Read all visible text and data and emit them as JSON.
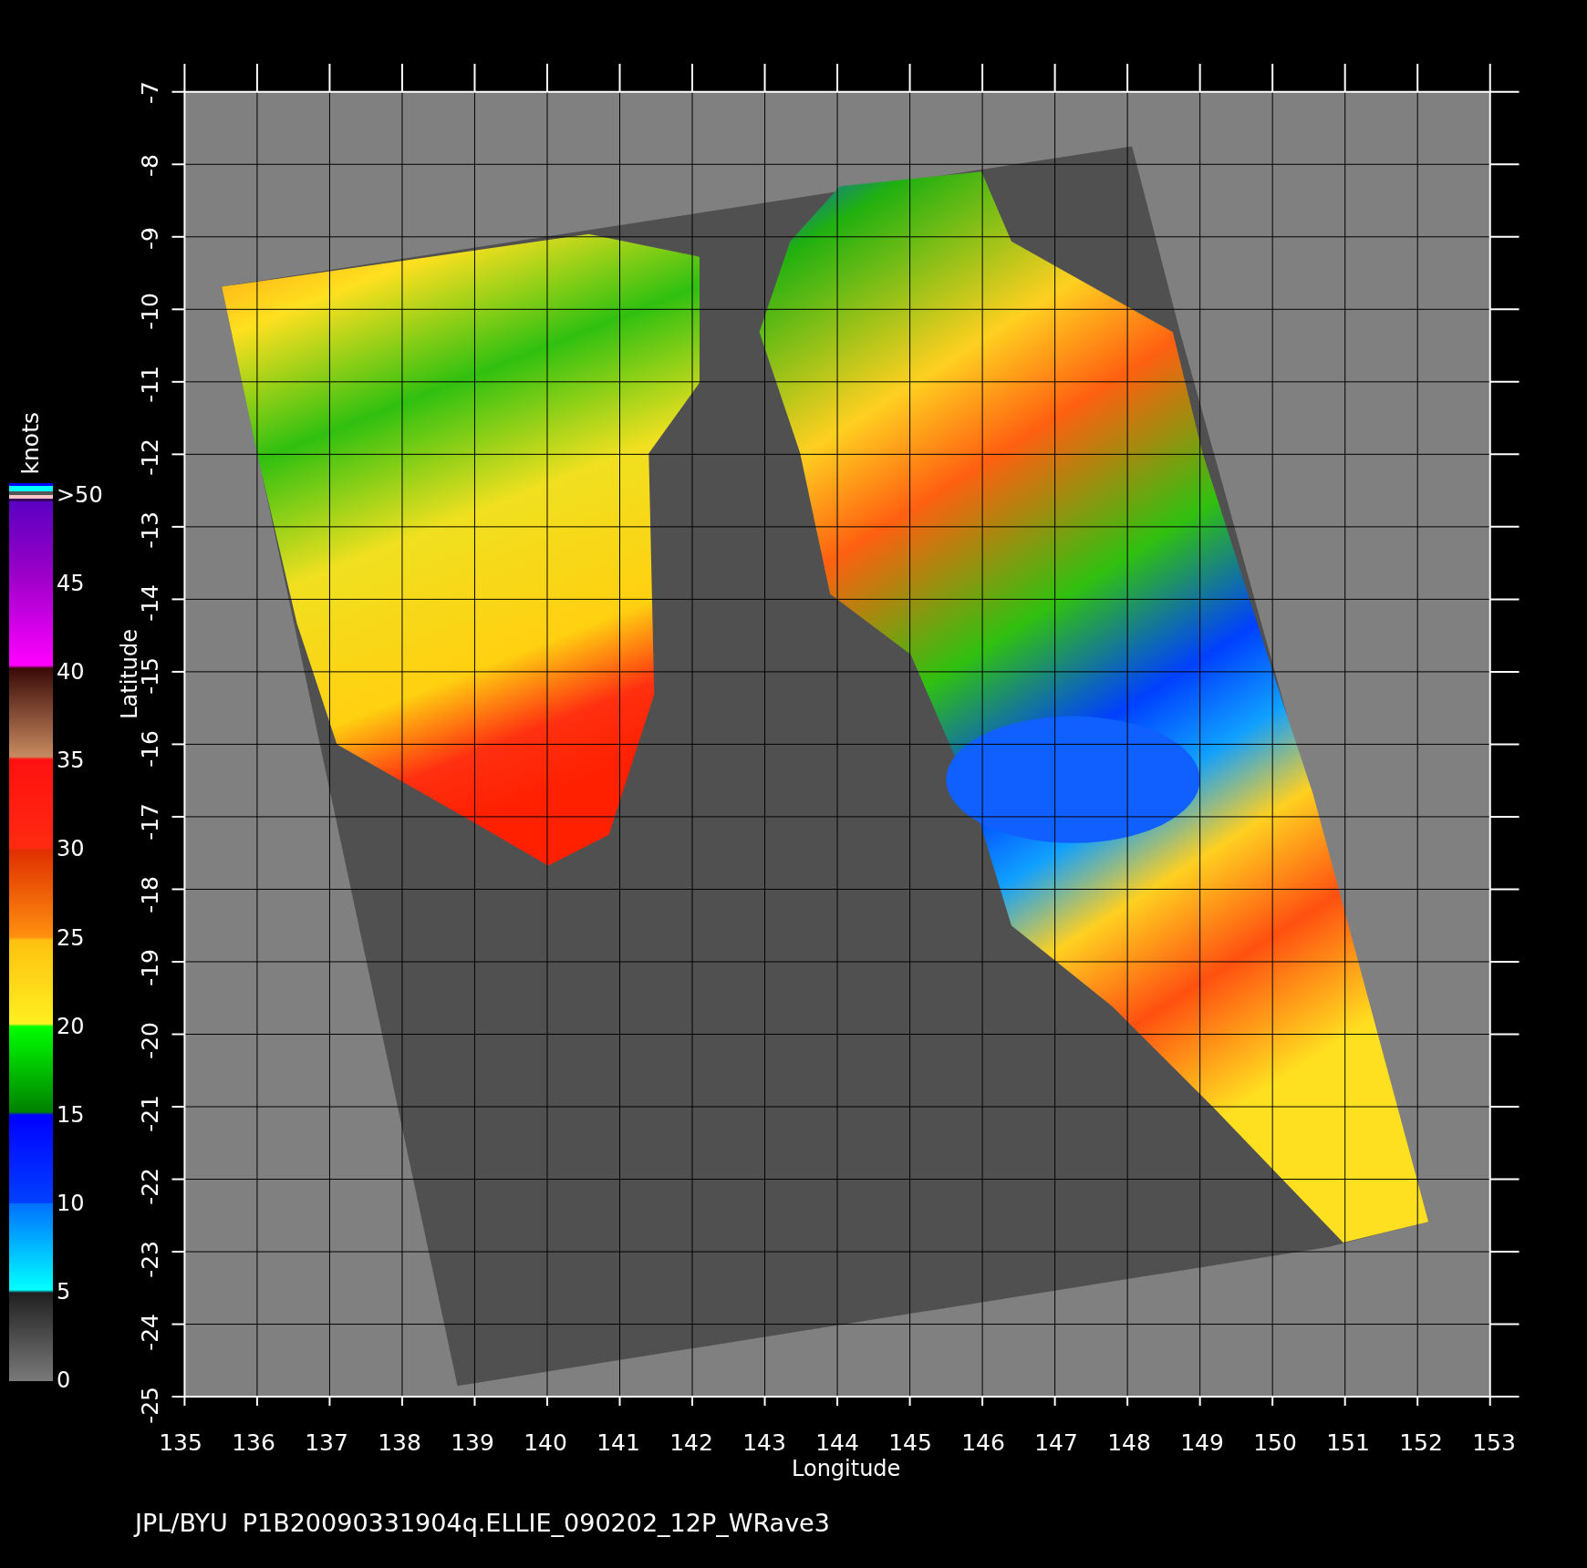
{
  "colorbar": {
    "title": "knots",
    "labels": [
      ">50",
      "45",
      "40",
      "35",
      "30",
      "25",
      "20",
      "15",
      "10",
      "5",
      "0"
    ]
  },
  "map": {
    "y_axis": {
      "title": "Latitude",
      "tick_labels": [
        "-7",
        "-8",
        "-9",
        "-10",
        "-11",
        "-12",
        "-13",
        "-14",
        "-15",
        "-16",
        "-17",
        "-18",
        "-19",
        "-20",
        "-21",
        "-22",
        "-23",
        "-24",
        "-25"
      ]
    },
    "x_axis": {
      "title": "Longitude",
      "tick_labels": [
        "135",
        "136",
        "137",
        "138",
        "139",
        "140",
        "141",
        "142",
        "143",
        "144",
        "145",
        "146",
        "147",
        "148",
        "149",
        "150",
        "151",
        "152",
        "153"
      ]
    }
  },
  "footer": {
    "source": "JPL/BYU",
    "file_name": "P1B20090331904q.ELLIE_090202_12P_WRave3"
  }
}
